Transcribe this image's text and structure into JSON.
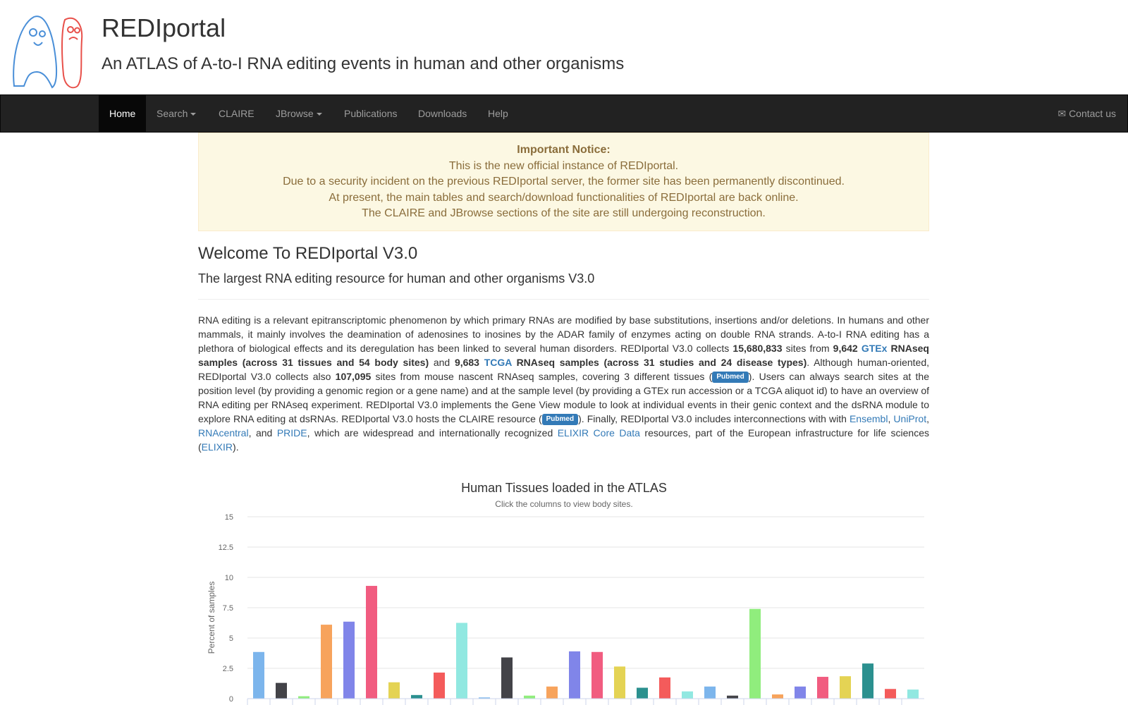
{
  "header": {
    "title": "REDIportal",
    "subtitle": "An ATLAS of A-to-I RNA editing events in human and other organisms"
  },
  "nav": {
    "home": "Home",
    "search": "Search",
    "claire": "CLAIRE",
    "jbrowse": "JBrowse",
    "publications": "Publications",
    "downloads": "Downloads",
    "help": "Help",
    "contact_icon": "✉",
    "contact": "Contact us"
  },
  "notice": {
    "title": "Important Notice:",
    "line1": "This is the new official instance of REDIportal.",
    "line2": "Due to a security incident on the previous REDIportal server, the former site has been permanently discontinued.",
    "line3": "At present, the main tables and search/download functionalities of REDIportal are back online.",
    "line4": "The CLAIRE and JBrowse sections of the site are still undergoing reconstruction."
  },
  "welcome": {
    "title": "Welcome To REDIportal V3.0",
    "tagline": "The largest RNA editing resource for human and other organisms V3.0"
  },
  "intro": {
    "s1": "RNA editing is a relevant epitranscriptomic phenomenon by which primary RNAs are modified by base substitutions, insertions and/or deletions. In humans and other mammals, it mainly involves the deamination of adenosines to inosines by the ADAR family of enzymes acting on double RNA strands. A-to-I RNA editing has a plethora of biological effects and its deregulation has been linked to several human disorders. REDIportal V3.0 collects ",
    "sites": "15,680,833",
    "s2": " sites from ",
    "gtex_n": "9,642",
    "gtex_link": "GTEx",
    "gtex_desc": " RNAseq samples (across 31 tissues and 54 body sites)",
    "s3": " and ",
    "tcga_n": "9,683",
    "tcga_link": "TCGA",
    "tcga_desc": " RNAseq samples (across 31 studies and 24 disease types)",
    "s4": ". Although human-oriented, REDIportal V3.0 collects also ",
    "mouse_n": "107,095",
    "s5": " sites from mouse nascent RNAseq samples, covering 3 different tissues (",
    "badge1": "Pubmed",
    "s6": "). Users can always search sites at the position level (by providing a genomic region or a gene name) and at the sample level (by providing a GTEx run accession or a TCGA aliquot id) to have an overview of RNA editing per RNAseq experiment. REDIportal V3.0 implements the Gene View module to look at individual events in their genic context and the dsRNA module to explore RNA editing at dsRNAs. REDIportal V3.0 hosts the CLAIRE resource (",
    "badge2": "Pubmed",
    "s7": "). Finally, REDIportal V3.0 includes interconnections with with ",
    "ensembl": "Ensembl",
    "comma1": ", ",
    "uniprot": "UniProt",
    "comma2": ", ",
    "rnacentral": "RNAcentral",
    "s8": ", and ",
    "pride": "PRIDE",
    "s9": ", which are widespread and internationally recognized ",
    "elixir_core": "ELIXIR Core Data",
    "s10": " resources, part of the European infrastructure for life sciences (",
    "elixir": "ELIXIR",
    "s11": ")."
  },
  "chart_data": {
    "type": "bar",
    "title": "Human Tissues loaded in the ATLAS",
    "subtitle": "Click the columns to view body sites.",
    "ylabel": "Percent of samples",
    "ylim": [
      0,
      15
    ],
    "yticks": [
      "0",
      "2.5",
      "5",
      "7.5",
      "10",
      "12.5",
      "15"
    ],
    "values": [
      3.85,
      1.3,
      0.2,
      6.1,
      6.35,
      9.3,
      1.35,
      0.3,
      2.15,
      6.25,
      0.1,
      3.4,
      0.25,
      1.0,
      3.9,
      3.85,
      2.65,
      0.9,
      1.75,
      0.6,
      1.0,
      0.25,
      7.4,
      0.35,
      1.0,
      1.8,
      1.85,
      2.9,
      0.8,
      0.75
    ],
    "colors": [
      "#7cb5ec",
      "#434348",
      "#90ed7d",
      "#f7a35c",
      "#8085e9",
      "#f15c80",
      "#e4d354",
      "#2b908f",
      "#f45b5b",
      "#91e8e1"
    ]
  }
}
